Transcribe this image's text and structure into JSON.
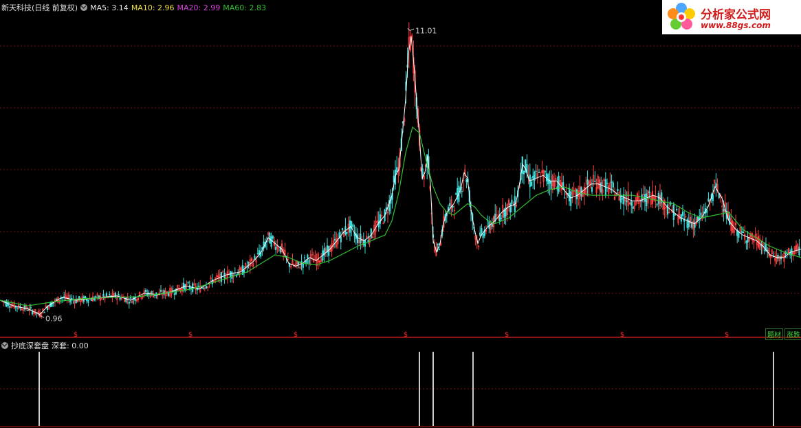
{
  "header": {
    "title": "新天科技(日线 前复权)",
    "ma5": "MA5: 3.14",
    "ma10": "MA10: 2.96",
    "ma20": "MA20: 2.99",
    "ma60": "MA60: 2.83"
  },
  "colors": {
    "ma5": "#ffffff",
    "ma10": "#f0e040",
    "ma20": "#e040e0",
    "ma60": "#30c030",
    "grid": "#7a1010",
    "separator": "#c01818",
    "signal": "#ffffff",
    "rising": "#ff4040",
    "falling": "#40e0e0"
  },
  "logo": {
    "brand": "分析家公式网",
    "url": "www.88gs.com",
    "icon": "flower-logo-icon"
  },
  "badges": {
    "finance": "题材",
    "limit_up": "涨跌"
  },
  "marker_glyph": "$",
  "indicator": {
    "name": "抄底深套盘",
    "value_label": "深套: 0.00"
  },
  "chart_data": [
    {
      "type": "line",
      "panel": "price",
      "annotations": [
        {
          "label": "11.01",
          "x": 596,
          "y": 11.01
        },
        {
          "label": "0.96",
          "x": 58,
          "y": 0.96
        }
      ],
      "x_range": [
        0,
        1165
      ],
      "ylim": [
        0.7,
        11.6
      ],
      "series": [
        {
          "name": "MA5",
          "color": "#ffffff",
          "x": [
            0,
            20,
            40,
            58,
            70,
            90,
            110,
            130,
            150,
            170,
            190,
            210,
            230,
            250,
            270,
            290,
            310,
            330,
            350,
            370,
            380,
            390,
            400,
            410,
            420,
            430,
            440,
            450,
            460,
            470,
            480,
            490,
            500,
            510,
            520,
            530,
            540,
            550,
            560,
            570,
            575,
            580,
            585,
            590,
            594,
            598,
            602,
            606,
            610,
            614,
            618,
            622,
            626,
            630,
            635,
            640,
            645,
            650,
            660,
            670,
            675,
            680,
            685,
            690,
            695,
            700,
            710,
            720,
            730,
            740,
            750,
            755,
            760,
            765,
            770,
            780,
            790,
            800,
            810,
            820,
            830,
            840,
            850,
            860,
            870,
            880,
            890,
            900,
            910,
            920,
            930,
            940,
            950,
            960,
            970,
            980,
            990,
            1000,
            1010,
            1020,
            1030,
            1040,
            1050,
            1060,
            1070,
            1080,
            1090,
            1100,
            1110,
            1120,
            1130,
            1140,
            1150,
            1165
          ],
          "values": [
            1.5,
            1.3,
            1.2,
            1.0,
            1.3,
            1.6,
            1.5,
            1.55,
            1.6,
            1.65,
            1.5,
            1.75,
            1.7,
            1.8,
            2.0,
            1.9,
            2.2,
            2.4,
            2.5,
            2.9,
            3.2,
            3.7,
            3.5,
            3.3,
            2.8,
            2.7,
            2.8,
            3.0,
            2.9,
            3.1,
            3.3,
            3.6,
            3.9,
            4.1,
            3.7,
            3.6,
            3.8,
            4.2,
            4.5,
            5.2,
            5.9,
            6.1,
            7.3,
            8.6,
            10.2,
            10.8,
            9.8,
            8.5,
            7.3,
            5.8,
            6.0,
            6.6,
            5.6,
            3.6,
            3.2,
            3.5,
            4.2,
            4.6,
            4.9,
            5.4,
            6.0,
            5.8,
            4.7,
            4.0,
            3.5,
            3.8,
            4.1,
            4.3,
            4.6,
            4.8,
            4.9,
            5.5,
            6.3,
            6.1,
            5.7,
            5.8,
            5.9,
            5.7,
            5.7,
            5.4,
            5.1,
            5.2,
            5.4,
            5.6,
            5.6,
            5.5,
            5.4,
            5.2,
            5.1,
            5.0,
            5.0,
            5.1,
            5.2,
            5.1,
            4.8,
            4.6,
            4.4,
            4.3,
            4.2,
            4.4,
            4.8,
            5.5,
            5.1,
            4.3,
            4.0,
            3.8,
            3.7,
            3.6,
            3.4,
            3.1,
            3.0,
            3.0,
            3.2,
            3.3
          ]
        },
        {
          "name": "MA60",
          "color": "#30c030",
          "x": [
            0,
            40,
            80,
            120,
            160,
            200,
            240,
            280,
            320,
            360,
            400,
            420,
            440,
            460,
            480,
            500,
            520,
            540,
            560,
            570,
            580,
            590,
            600,
            610,
            620,
            630,
            640,
            650,
            660,
            670,
            680,
            690,
            700,
            710,
            720,
            740,
            760,
            780,
            800,
            820,
            840,
            860,
            880,
            900,
            920,
            940,
            960,
            980,
            1000,
            1020,
            1040,
            1060,
            1080,
            1100,
            1120,
            1140,
            1165
          ],
          "values": [
            1.5,
            1.3,
            1.45,
            1.55,
            1.6,
            1.62,
            1.75,
            1.9,
            2.2,
            2.5,
            3.1,
            3.0,
            2.8,
            2.75,
            2.9,
            3.15,
            3.4,
            3.6,
            3.8,
            4.3,
            5.3,
            6.7,
            7.6,
            7.4,
            6.4,
            5.5,
            4.9,
            4.6,
            4.5,
            4.7,
            4.9,
            4.8,
            4.5,
            4.3,
            4.2,
            4.4,
            4.8,
            5.2,
            5.4,
            5.5,
            5.3,
            5.2,
            5.2,
            5.2,
            5.2,
            5.1,
            5.0,
            4.9,
            4.6,
            4.4,
            4.5,
            4.6,
            4.0,
            3.7,
            3.4,
            3.2,
            3.0
          ]
        }
      ]
    },
    {
      "type": "bar",
      "panel": "indicator",
      "name": "深套",
      "signal_x": [
        57,
        610,
        630,
        688,
        1125
      ],
      "values": [
        1,
        1,
        1,
        1,
        1
      ],
      "ylim": [
        0,
        1
      ]
    }
  ]
}
